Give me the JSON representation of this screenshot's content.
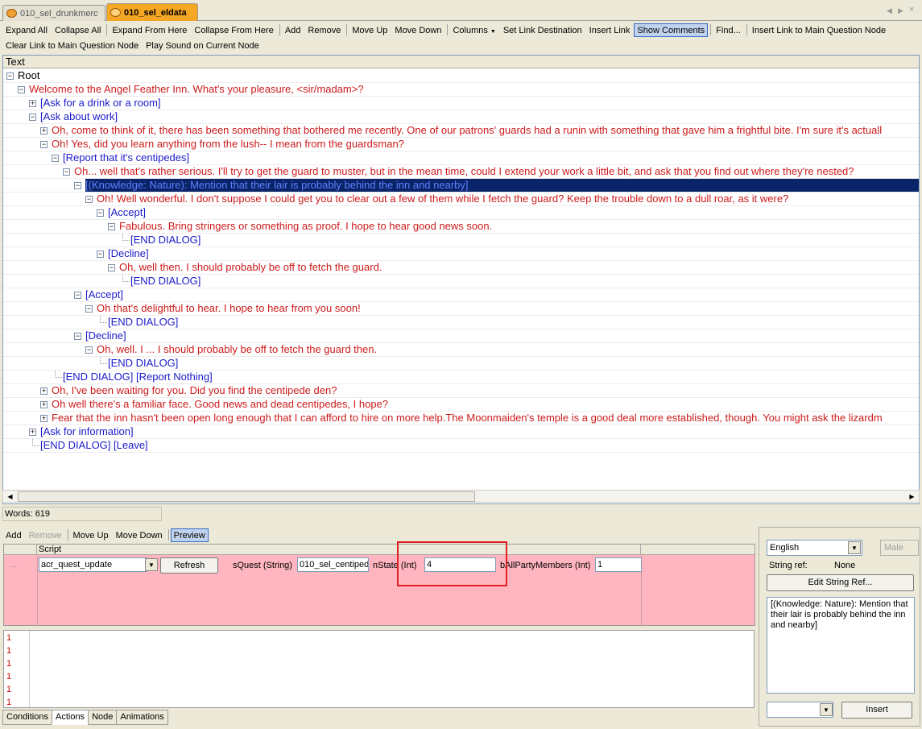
{
  "tabs": [
    {
      "label": "010_sel_drunkmerc",
      "active": false
    },
    {
      "label": "010_sel_eldata",
      "active": true
    }
  ],
  "toolbar": {
    "row1": [
      "Expand All",
      "Collapse All",
      "Expand From Here",
      "Collapse From Here",
      "Add",
      "Remove",
      "Move Up",
      "Move Down",
      "Columns",
      "Set Link Destination",
      "Insert Link",
      "Show Comments",
      "Find...",
      "Insert Link to Main Question Node"
    ],
    "row2": [
      "Clear Link to Main Question Node",
      "Play Sound on Current Node"
    ]
  },
  "tree": {
    "header": "Text",
    "rows": [
      {
        "text": "Root",
        "indent": 0,
        "kind": "black",
        "expander": "minus"
      },
      {
        "text": "Welcome to the Angel Feather Inn. What's your pleasure, <sir/madam>?",
        "indent": 1,
        "kind": "red",
        "expander": "minus"
      },
      {
        "text": "[Ask for a drink or a room]",
        "indent": 2,
        "kind": "blue",
        "expander": "plus"
      },
      {
        "text": "[Ask about work]",
        "indent": 2,
        "kind": "blue",
        "expander": "minus"
      },
      {
        "text": "Oh, come to think of it, there has been something that bothered me recently. One of our patrons' guards had a runin with something that gave him a frightful bite. I'm sure it's actuall",
        "indent": 3,
        "kind": "red",
        "expander": "plus"
      },
      {
        "text": "Oh! Yes, did you learn anything from the lush-- I mean from the guardsman?",
        "indent": 3,
        "kind": "red",
        "expander": "minus"
      },
      {
        "text": "[Report that it's centipedes]",
        "indent": 4,
        "kind": "blue",
        "expander": "minus"
      },
      {
        "text": "Oh... well that's rather serious. I'll try to get the guard to muster, but in the mean time, could I extend your work a little bit, and ask that you find out where they're nested?",
        "indent": 5,
        "kind": "red",
        "expander": "minus"
      },
      {
        "text": "[(Knowledge: Nature): Mention that their lair is probably behind the inn and nearby]",
        "indent": 6,
        "kind": "sel",
        "expander": "minus"
      },
      {
        "text": "Oh! Well wonderful. I don't suppose I could get you to clear out a few of them while I fetch the guard? Keep the trouble down to a dull roar, as it were?",
        "indent": 7,
        "kind": "red",
        "expander": "minus"
      },
      {
        "text": "[Accept]",
        "indent": 8,
        "kind": "blue",
        "expander": "minus"
      },
      {
        "text": "Fabulous. Bring stringers or something as proof. I hope to hear good news soon.",
        "indent": 9,
        "kind": "red",
        "expander": "minus"
      },
      {
        "text": "[END DIALOG]",
        "indent": 10,
        "kind": "blue",
        "expander": "leaf"
      },
      {
        "text": "[Decline]",
        "indent": 8,
        "kind": "blue",
        "expander": "minus"
      },
      {
        "text": "Oh, well then. I should probably be off to fetch the guard.",
        "indent": 9,
        "kind": "red",
        "expander": "minus"
      },
      {
        "text": "[END DIALOG]",
        "indent": 10,
        "kind": "blue",
        "expander": "leaf"
      },
      {
        "text": "[Accept]",
        "indent": 6,
        "kind": "blue",
        "expander": "minus"
      },
      {
        "text": "Oh that's delightful to hear. I hope to hear from you soon!",
        "indent": 7,
        "kind": "red",
        "expander": "minus"
      },
      {
        "text": "[END DIALOG]",
        "indent": 8,
        "kind": "blue",
        "expander": "leaf"
      },
      {
        "text": "[Decline]",
        "indent": 6,
        "kind": "blue",
        "expander": "minus"
      },
      {
        "text": "Oh, well. I ... I should probably be off to fetch the guard then.",
        "indent": 7,
        "kind": "red",
        "expander": "minus"
      },
      {
        "text": "[END DIALOG]",
        "indent": 8,
        "kind": "blue",
        "expander": "leaf"
      },
      {
        "text": "[END DIALOG] [Report Nothing]",
        "indent": 4,
        "kind": "blue",
        "expander": "leaf"
      },
      {
        "text": "Oh, I've been waiting for you. Did you find the centipede den?",
        "indent": 3,
        "kind": "red",
        "expander": "plus"
      },
      {
        "text": "Oh well there's a familiar face. Good news and dead centipedes, I hope?",
        "indent": 3,
        "kind": "red",
        "expander": "plus"
      },
      {
        "text": "Fear that the inn hasn't been open long enough that I can afford to hire on more help.The Moonmaiden's temple is a good deal more established, though. You might ask the lizardm",
        "indent": 3,
        "kind": "red",
        "expander": "plus"
      },
      {
        "text": "[Ask for information]",
        "indent": 2,
        "kind": "blue",
        "expander": "plus"
      },
      {
        "text": "[END DIALOG] [Leave]",
        "indent": 2,
        "kind": "blue",
        "expander": "leaf"
      }
    ]
  },
  "status": {
    "words": "Words: 619"
  },
  "actions_toolbar": {
    "add": "Add",
    "remove": "Remove",
    "move_up": "Move Up",
    "move_down": "Move Down",
    "preview": "Preview"
  },
  "script_grid": {
    "header": "Script",
    "row_marker": "...",
    "script_name": "acr_quest_update",
    "refresh": "Refresh",
    "params": [
      {
        "label": "sQuest (String)",
        "value": "010_sel_centiped"
      },
      {
        "label": "nState (Int)",
        "value": "4"
      },
      {
        "label": "bAllPartyMembers (Int)",
        "value": "1"
      }
    ]
  },
  "script_lines": [
    "1",
    "1",
    "1",
    "1",
    "1",
    "1"
  ],
  "bottom_tabs": [
    {
      "label": "Conditions",
      "active": false
    },
    {
      "label": "Actions",
      "active": true
    },
    {
      "label": "Node",
      "active": false
    },
    {
      "label": "Animations",
      "active": false
    }
  ],
  "right_panel": {
    "language": "English",
    "gender": "Male",
    "string_ref_label": "String ref:",
    "string_ref_value": "None",
    "edit_button": "Edit String Ref...",
    "comment": "[(Knowledge: Nature): Mention that their lair is probably behind the inn and nearby]",
    "insert_button": "Insert"
  },
  "colors": {
    "npc_text": "#cc1b1b",
    "player_text": "#1b1bcc",
    "selection": "#0a246a",
    "grid_bg": "#ffb6c1",
    "highlight_box": "#e02020"
  }
}
